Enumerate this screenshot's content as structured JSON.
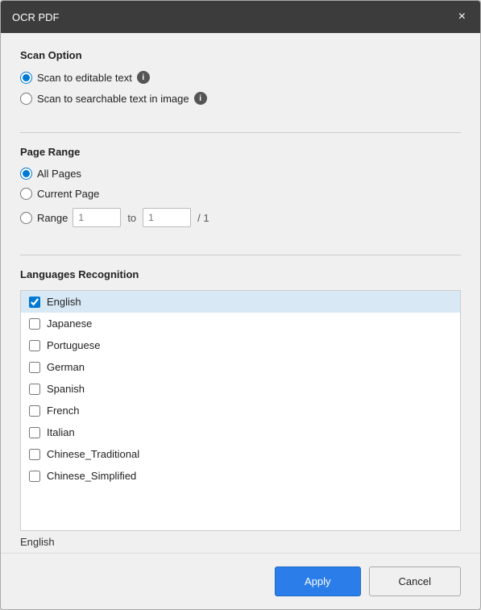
{
  "dialog": {
    "title": "OCR PDF",
    "close_label": "×"
  },
  "scan_option": {
    "section_title": "Scan Option",
    "options": [
      {
        "id": "scan-editable",
        "label": "Scan to editable text",
        "has_info": true,
        "checked": true
      },
      {
        "id": "scan-searchable",
        "label": "Scan to searchable text in image",
        "has_info": true,
        "checked": false
      }
    ]
  },
  "page_range": {
    "section_title": "Page Range",
    "options": [
      {
        "id": "all-pages",
        "label": "All Pages",
        "checked": true
      },
      {
        "id": "current-page",
        "label": "Current Page",
        "checked": false
      },
      {
        "id": "range",
        "label": "Range",
        "checked": false
      }
    ],
    "range_from_placeholder": "1",
    "range_to_placeholder": "1",
    "range_to_label": "to",
    "range_total": "/ 1"
  },
  "languages": {
    "section_title": "Languages Recognition",
    "items": [
      {
        "label": "English",
        "checked": true
      },
      {
        "label": "Japanese",
        "checked": false
      },
      {
        "label": "Portuguese",
        "checked": false
      },
      {
        "label": "German",
        "checked": false
      },
      {
        "label": "Spanish",
        "checked": false
      },
      {
        "label": "French",
        "checked": false
      },
      {
        "label": "Italian",
        "checked": false
      },
      {
        "label": "Chinese_Traditional",
        "checked": false
      },
      {
        "label": "Chinese_Simplified",
        "checked": false
      }
    ],
    "selected_display": "English"
  },
  "footer": {
    "apply_label": "Apply",
    "cancel_label": "Cancel"
  }
}
